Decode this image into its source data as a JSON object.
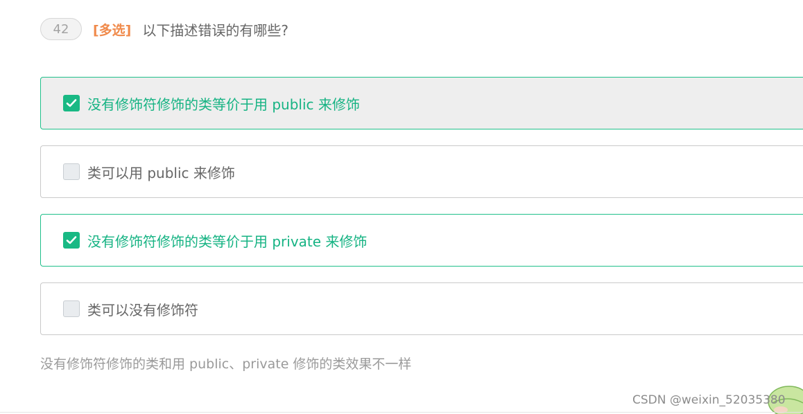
{
  "question": {
    "number": "42",
    "tag": "[多选]",
    "text": "以下描述错误的有哪些?"
  },
  "options": [
    {
      "label": "没有修饰符修饰的类等价于用 public 来修饰",
      "checked": true
    },
    {
      "label": "类可以用 public 来修饰",
      "checked": false
    },
    {
      "label": "没有修饰符修饰的类等价于用 private 来修饰",
      "checked": true
    },
    {
      "label": "类可以没有修饰符",
      "checked": false
    }
  ],
  "explanation": "没有修饰符修饰的类和用 public、private 修饰的类效果不一样",
  "watermark": "CSDN @weixin_52035380",
  "colors": {
    "accent": "#19b984",
    "tag": "#f08a4b",
    "highlight_bg": "#eeeeee"
  },
  "icons": {
    "checked": "checkbox-checked-icon",
    "unchecked": "checkbox-unchecked-icon",
    "decoration": "cartoon-leaf-icon"
  }
}
